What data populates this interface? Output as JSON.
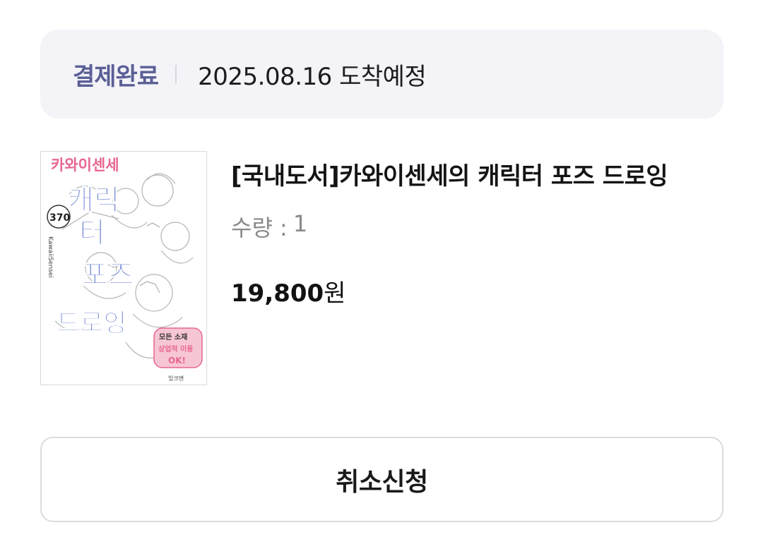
{
  "order": {
    "status_label": "결제완료",
    "delivery_date": "2025.08.16 도착예정"
  },
  "product": {
    "title": "[국내도서]카와이센세의 캐릭터 포즈 드로잉",
    "quantity_label": "수량 :",
    "quantity_value": "1",
    "price_number": "19,800",
    "price_unit": "원",
    "cover": {
      "top_text": "카와이센세",
      "main_text_1": "캐릭",
      "main_text_2": "터",
      "main_text_3": "포즈",
      "main_text_4": "드로잉",
      "badge_text": "370",
      "side_text": "KawaiiSensei",
      "sticker_line1": "모든 소재",
      "sticker_line2": "상업적 이용",
      "sticker_line3": "OK!",
      "publisher": "잉크앤"
    }
  },
  "actions": {
    "cancel_label": "취소신청"
  },
  "colors": {
    "status_label": "#5a5f95",
    "status_background": "#f3f3f8",
    "cover_title_blue": "#4a63c9",
    "cover_title_pink": "#e8668f"
  }
}
